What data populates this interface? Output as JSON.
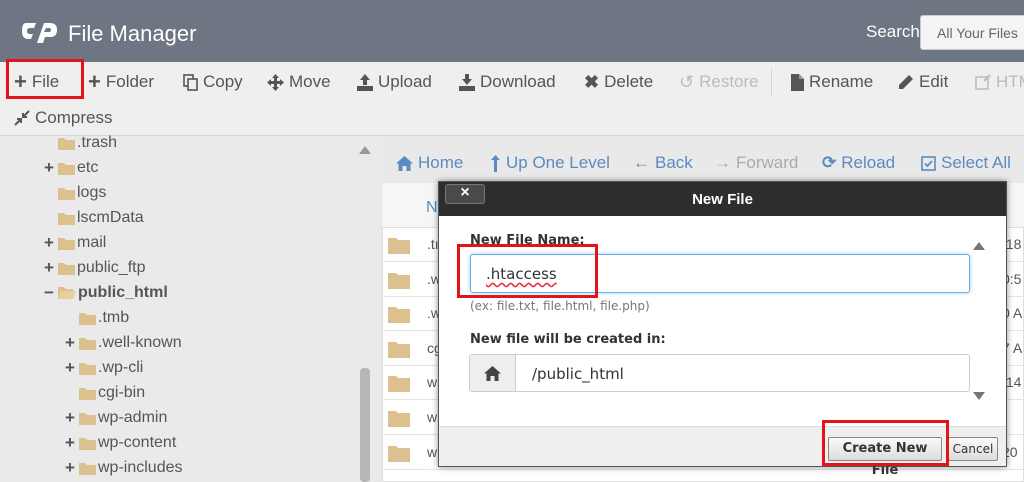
{
  "header": {
    "title": "File Manager",
    "search_label": "Search",
    "search_scope": "All Your Files"
  },
  "toolbar": {
    "file": "File",
    "folder": "Folder",
    "copy": "Copy",
    "move": "Move",
    "upload": "Upload",
    "download": "Download",
    "delete": "Delete",
    "restore": "Restore",
    "rename": "Rename",
    "edit": "Edit",
    "html_editor": "HTM",
    "compress": "Compress"
  },
  "sidebar": {
    "items": [
      {
        "label": ".trash"
      },
      {
        "label": "etc"
      },
      {
        "label": "logs"
      },
      {
        "label": "lscmData"
      },
      {
        "label": "mail"
      },
      {
        "label": "public_ftp"
      },
      {
        "label": "public_html"
      },
      {
        "label": ".tmb"
      },
      {
        "label": ".well-known"
      },
      {
        "label": ".wp-cli"
      },
      {
        "label": "cgi-bin"
      },
      {
        "label": "wp-admin"
      },
      {
        "label": "wp-content"
      },
      {
        "label": "wp-includes"
      }
    ]
  },
  "navbar": {
    "home": "Home",
    "up": "Up One Level",
    "back": "Back",
    "forward": "Forward",
    "reload": "Reload",
    "select_all": "Select All"
  },
  "filelist": {
    "name_header": "N",
    "rows": [
      {
        "name": ".tı",
        "date": ":18"
      },
      {
        "name": ".w",
        "date": "0:5"
      },
      {
        "name": ".w",
        "date": "0 A"
      },
      {
        "name": "cg",
        "date": "7 A"
      },
      {
        "name": "w",
        "date": ":14"
      },
      {
        "name": "w",
        "date": ""
      },
      {
        "name": "w",
        "date": "20"
      }
    ]
  },
  "dialog": {
    "title": "New File",
    "close": "×",
    "name_label": "New File Name:",
    "name_value": ".htaccess",
    "hint": "(ex: file.txt, file.html, file.php)",
    "location_label": "New file will be created in:",
    "location_value": "/public_html",
    "create_button": "Create New File",
    "cancel_button": "Cancel"
  },
  "colors": {
    "header_bg": "#6e7683",
    "link_blue": "#5b8bc2",
    "folder": "#dcc08f",
    "highlight_red": "#e2141b"
  }
}
